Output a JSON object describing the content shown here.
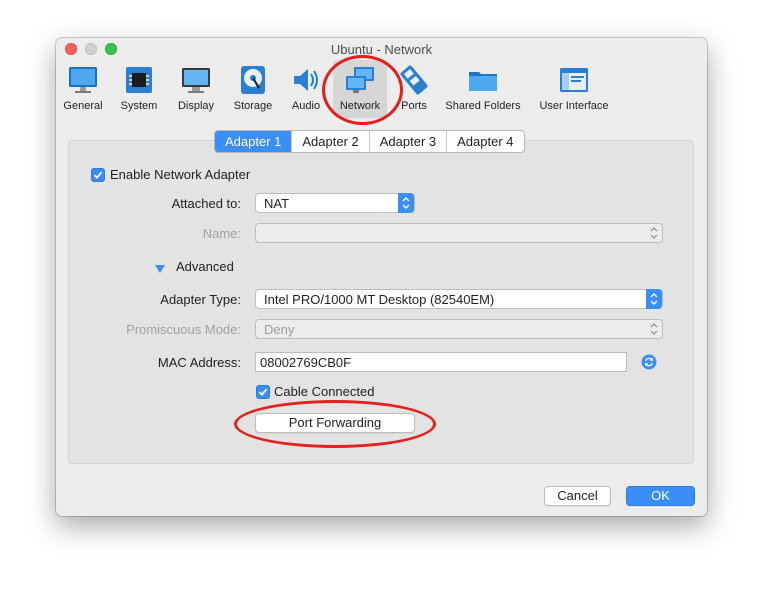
{
  "window": {
    "title": "Ubuntu - Network"
  },
  "toolbar": {
    "items": [
      {
        "label": "General",
        "icon": "monitor-icon"
      },
      {
        "label": "System",
        "icon": "chip-icon"
      },
      {
        "label": "Display",
        "icon": "display-icon"
      },
      {
        "label": "Storage",
        "icon": "disk-icon"
      },
      {
        "label": "Audio",
        "icon": "speaker-icon"
      },
      {
        "label": "Network",
        "icon": "network-icon",
        "selected": true
      },
      {
        "label": "Ports",
        "icon": "ports-icon"
      },
      {
        "label": "Shared Folders",
        "icon": "folder-icon"
      },
      {
        "label": "User Interface",
        "icon": "ui-window-icon"
      }
    ]
  },
  "tabs": [
    {
      "label": "Adapter 1",
      "active": true
    },
    {
      "label": "Adapter 2"
    },
    {
      "label": "Adapter 3"
    },
    {
      "label": "Adapter 4"
    }
  ],
  "form": {
    "enable_adapter_label": "Enable Network Adapter",
    "enable_adapter_checked": true,
    "attached_to_label": "Attached to:",
    "attached_to_value": "NAT",
    "name_label": "Name:",
    "name_value": "",
    "advanced_label": "Advanced",
    "adapter_type_label": "Adapter Type:",
    "adapter_type_value": "Intel PRO/1000 MT Desktop (82540EM)",
    "promiscuous_label": "Promiscuous Mode:",
    "promiscuous_value": "Deny",
    "mac_label": "MAC Address:",
    "mac_value": "08002769CB0F",
    "cable_label": "Cable Connected",
    "cable_checked": true,
    "port_forwarding_label": "Port Forwarding"
  },
  "footer": {
    "cancel_label": "Cancel",
    "ok_label": "OK"
  },
  "colors": {
    "accent": "#3a8ef6",
    "annotation": "#e3201b"
  }
}
